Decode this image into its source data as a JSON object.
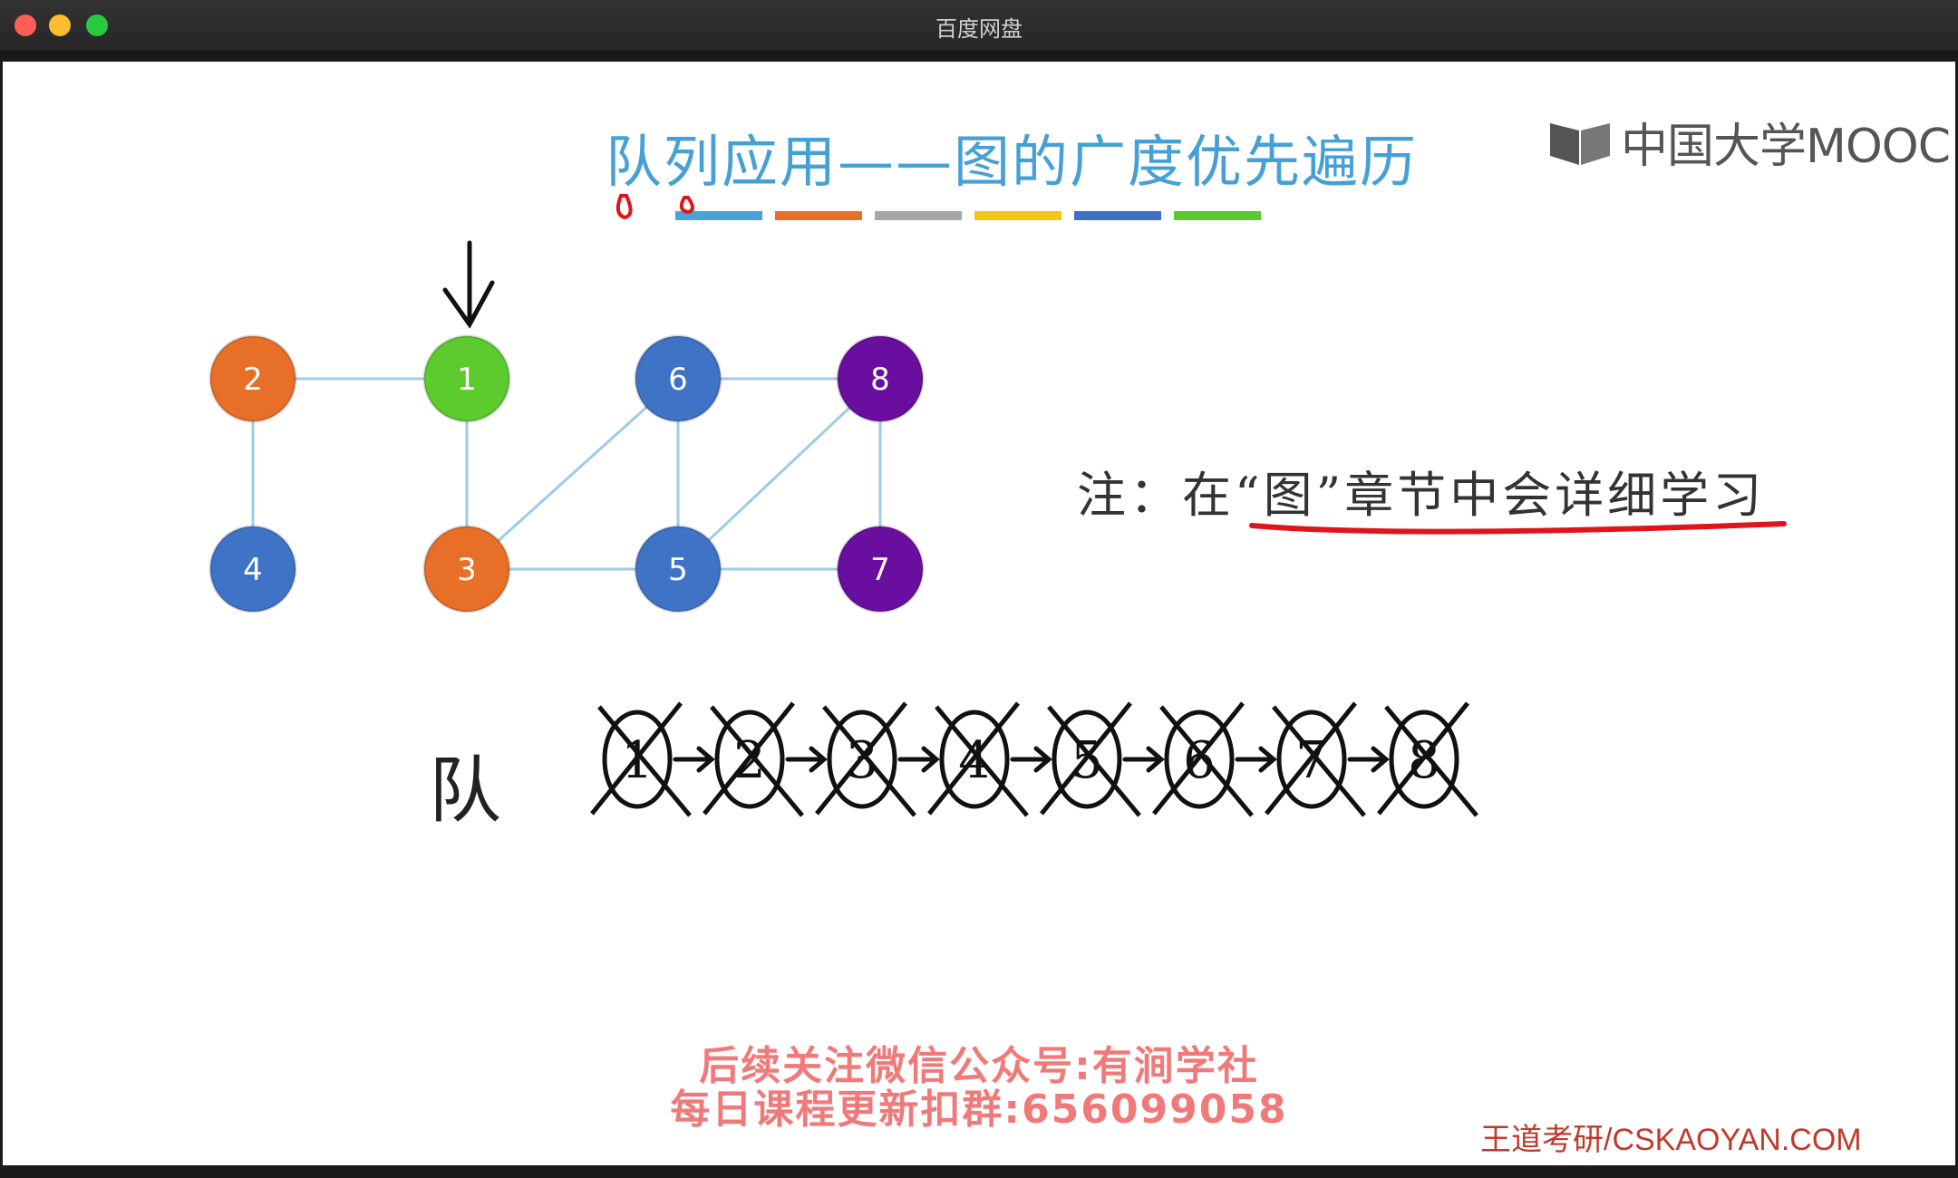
{
  "window": {
    "title": "百度网盘"
  },
  "slide": {
    "title": "队列应用——图的广度优先遍历",
    "logo_text": "中国大学MOOC",
    "note": "注：在“图”章节中会详细学习",
    "queue_label": "队",
    "promo_line1": "后续关注微信公众号:有涧学社",
    "promo_line2": "每日课程更新扣群:656099058",
    "watermark": "王道考研/CSKAOYAN.COM",
    "title_bar_colors": [
      "#4aa3d8",
      "#e86f27",
      "#a6a6a6",
      "#f5c518",
      "#3d6fc4",
      "#5cc832"
    ]
  },
  "graph": {
    "nodes": [
      {
        "id": "1",
        "label": "1",
        "color": "#5ccb2e"
      },
      {
        "id": "2",
        "label": "2",
        "color": "#e86f27"
      },
      {
        "id": "3",
        "label": "3",
        "color": "#e86f27"
      },
      {
        "id": "4",
        "label": "4",
        "color": "#3f73c6"
      },
      {
        "id": "5",
        "label": "5",
        "color": "#3f73c6"
      },
      {
        "id": "6",
        "label": "6",
        "color": "#3f73c6"
      },
      {
        "id": "7",
        "label": "7",
        "color": "#6a0ea0"
      },
      {
        "id": "8",
        "label": "8",
        "color": "#6a0ea0"
      }
    ],
    "edges": [
      [
        "2",
        "1"
      ],
      [
        "2",
        "4"
      ],
      [
        "1",
        "3"
      ],
      [
        "3",
        "5"
      ],
      [
        "3",
        "6"
      ],
      [
        "6",
        "5"
      ],
      [
        "6",
        "8"
      ],
      [
        "5",
        "7"
      ],
      [
        "5",
        "8"
      ],
      [
        "8",
        "7"
      ]
    ]
  },
  "queue": {
    "items": [
      "1",
      "2",
      "3",
      "4",
      "5",
      "6",
      "7",
      "8"
    ]
  }
}
